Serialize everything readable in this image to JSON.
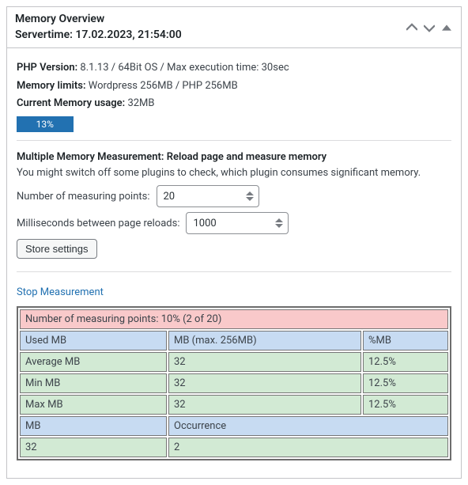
{
  "header": {
    "title_line1": "Memory Overview",
    "title_line2": "Servertime: 17.02.2023, 21:54:00"
  },
  "php": {
    "version_label": "PHP Version:",
    "version_value": "8.1.13 / 64Bit OS / Max execution time: 30sec",
    "limits_label": "Memory limits:",
    "limits_value": "Wordpress 256MB / PHP 256MB",
    "current_label": "Current Memory usage:",
    "current_value": "32MB",
    "progress_pct": "13",
    "progress_text": "13%"
  },
  "multi": {
    "heading": "Multiple Memory Measurement: Reload page and measure memory",
    "hint": "You might switch off some plugins to check, which plugin consumes significant memory.",
    "points_label": "Number of measuring points:",
    "points_value": "20",
    "ms_label": "Milliseconds between page reloads:",
    "ms_value": "1000",
    "store_button": "Store settings",
    "stop_link": "Stop Measurement"
  },
  "table": {
    "summary": "Number of measuring points: 10% (2 of 20)",
    "hdr_mb": "Used MB",
    "hdr_max": "MB (max. 256MB)",
    "hdr_pct": "%MB",
    "avg_lbl": "Average MB",
    "avg_val": "32",
    "avg_pct": "12.5%",
    "min_lbl": "Min MB",
    "min_val": "32",
    "min_pct": "12.5%",
    "max_lbl": "Max MB",
    "max_val": "32",
    "max_pct": "12.5%",
    "occ_hdr_mb": "MB",
    "occ_hdr_occ": "Occurrence",
    "occ_val_mb": "32",
    "occ_val_occ": "2"
  }
}
